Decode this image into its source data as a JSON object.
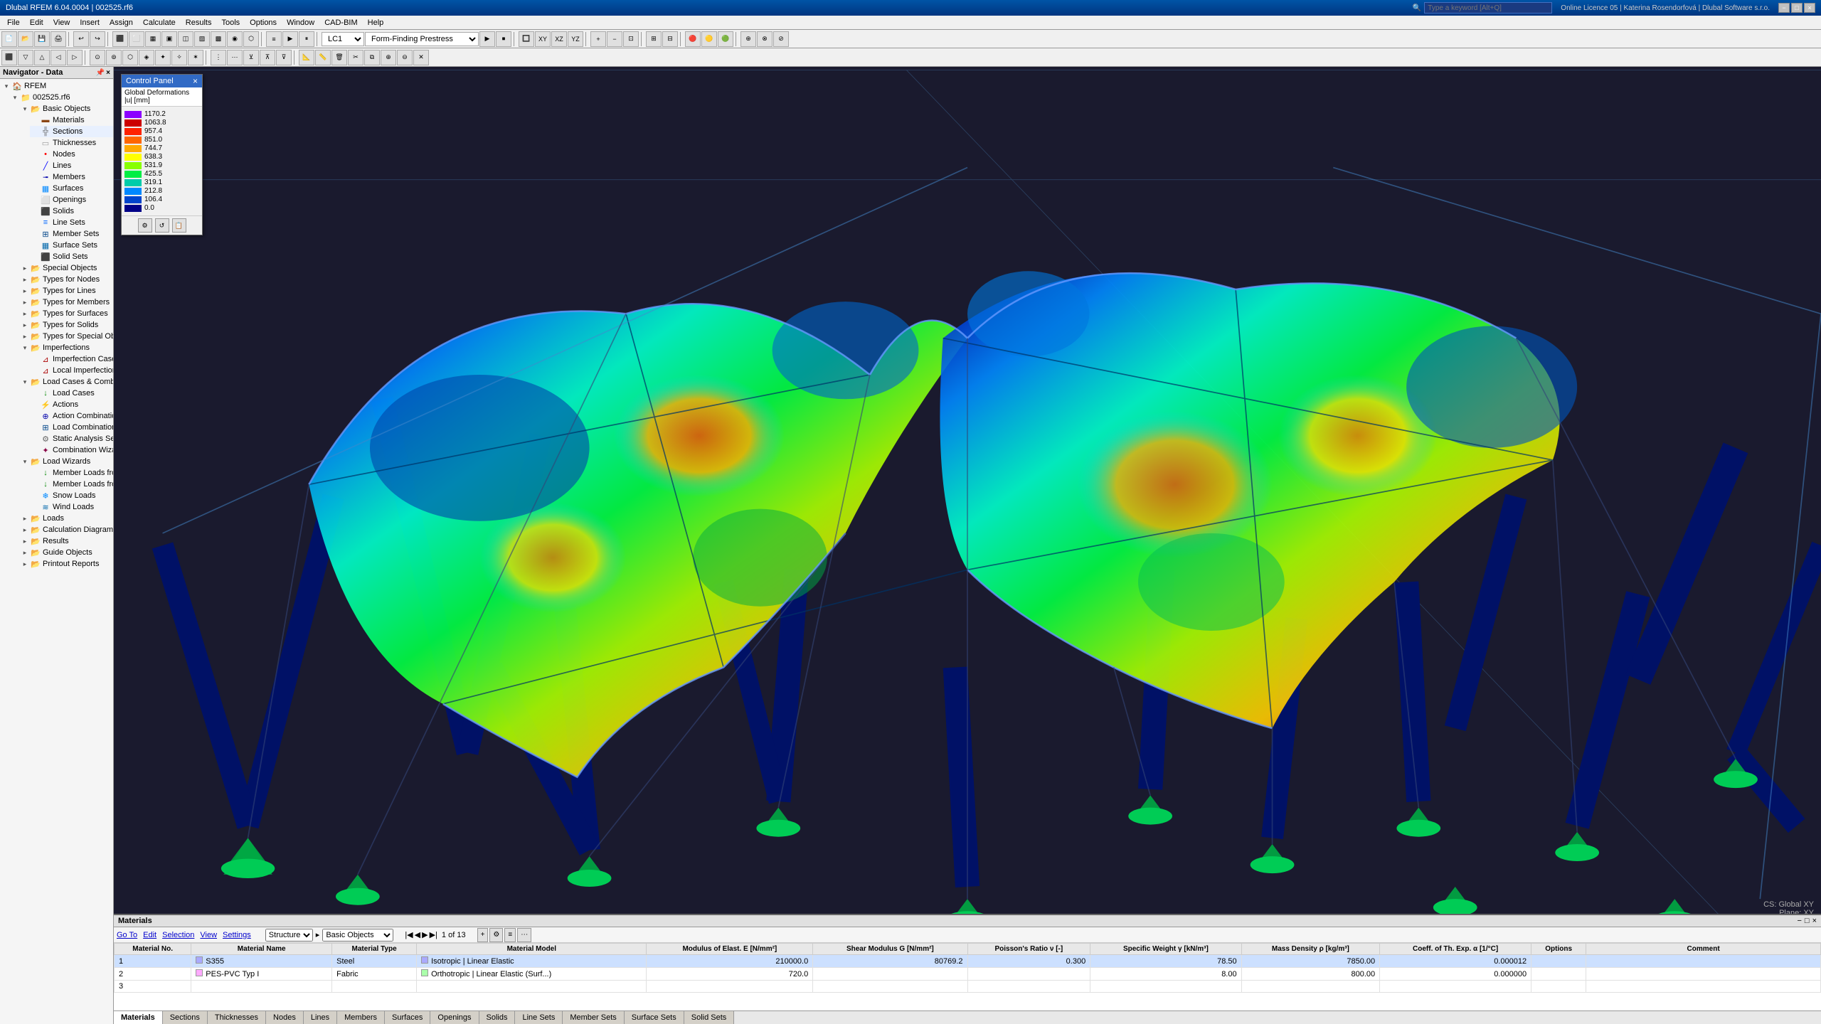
{
  "title_bar": {
    "title": "Dlubal RFEM 6.04.0004 | 002525.rf6",
    "search_placeholder": "Type a keyword [Alt+Q]",
    "license_info": "Online Licence 05 | Katerina Rosendorfová | Dlubal Software s.r.o.",
    "min_label": "−",
    "max_label": "□",
    "close_label": "×"
  },
  "menu": {
    "items": [
      "File",
      "Edit",
      "View",
      "Insert",
      "Assign",
      "Calculate",
      "Results",
      "Tools",
      "Options",
      "Window",
      "CAD-BIM",
      "Help"
    ]
  },
  "toolbar": {
    "lc_label": "LC1",
    "ff_label": "Form-Finding Prestress"
  },
  "navigator": {
    "title": "Navigator - Data",
    "rfem_label": "RFEM",
    "file_label": "002525.rf6",
    "sections": [
      {
        "label": "Basic Objects",
        "expanded": true,
        "level": 1,
        "icon": "folder"
      },
      {
        "label": "Materials",
        "expanded": false,
        "level": 2,
        "icon": "material"
      },
      {
        "label": "Sections",
        "expanded": false,
        "level": 2,
        "icon": "section"
      },
      {
        "label": "Thicknesses",
        "expanded": false,
        "level": 2,
        "icon": "thickness"
      },
      {
        "label": "Nodes",
        "expanded": false,
        "level": 2,
        "icon": "node"
      },
      {
        "label": "Lines",
        "expanded": false,
        "level": 2,
        "icon": "line"
      },
      {
        "label": "Members",
        "expanded": false,
        "level": 2,
        "icon": "member"
      },
      {
        "label": "Surfaces",
        "expanded": false,
        "level": 2,
        "icon": "surface"
      },
      {
        "label": "Openings",
        "expanded": false,
        "level": 2,
        "icon": "opening"
      },
      {
        "label": "Solids",
        "expanded": false,
        "level": 2,
        "icon": "solid"
      },
      {
        "label": "Line Sets",
        "expanded": false,
        "level": 2,
        "icon": "lineset"
      },
      {
        "label": "Member Sets",
        "expanded": false,
        "level": 2,
        "icon": "memberset"
      },
      {
        "label": "Surface Sets",
        "expanded": false,
        "level": 2,
        "icon": "surfaceset"
      },
      {
        "label": "Solid Sets",
        "expanded": false,
        "level": 2,
        "icon": "solidset"
      },
      {
        "label": "Special Objects",
        "expanded": false,
        "level": 1,
        "icon": "folder"
      },
      {
        "label": "Types for Nodes",
        "expanded": false,
        "level": 1,
        "icon": "folder"
      },
      {
        "label": "Types for Lines",
        "expanded": false,
        "level": 1,
        "icon": "folder"
      },
      {
        "label": "Types for Members",
        "expanded": false,
        "level": 1,
        "icon": "folder"
      },
      {
        "label": "Types for Surfaces",
        "expanded": false,
        "level": 1,
        "icon": "folder"
      },
      {
        "label": "Types for Solids",
        "expanded": false,
        "level": 1,
        "icon": "folder"
      },
      {
        "label": "Types for Special Objects",
        "expanded": false,
        "level": 1,
        "icon": "folder"
      },
      {
        "label": "Imperfections",
        "expanded": true,
        "level": 1,
        "icon": "folder"
      },
      {
        "label": "Imperfection Cases",
        "expanded": false,
        "level": 2,
        "icon": "imp"
      },
      {
        "label": "Local Imperfections",
        "expanded": false,
        "level": 2,
        "icon": "imp"
      },
      {
        "label": "Load Cases & Combinations",
        "expanded": true,
        "level": 1,
        "icon": "folder"
      },
      {
        "label": "Load Cases",
        "expanded": false,
        "level": 2,
        "icon": "lc"
      },
      {
        "label": "Actions",
        "expanded": false,
        "level": 2,
        "icon": "action"
      },
      {
        "label": "Action Combinations",
        "expanded": false,
        "level": 2,
        "icon": "combination"
      },
      {
        "label": "Load Combinations",
        "expanded": false,
        "level": 2,
        "icon": "combination"
      },
      {
        "label": "Static Analysis Settings",
        "expanded": false,
        "level": 2,
        "icon": "settings"
      },
      {
        "label": "Combination Wizards",
        "expanded": false,
        "level": 2,
        "icon": "wizard"
      },
      {
        "label": "Load Wizards",
        "expanded": true,
        "level": 1,
        "icon": "folder"
      },
      {
        "label": "Member Loads from Area Load",
        "expanded": false,
        "level": 2,
        "icon": "load"
      },
      {
        "label": "Member Loads from Free Line Load",
        "expanded": false,
        "level": 2,
        "icon": "load"
      },
      {
        "label": "Snow Loads",
        "expanded": false,
        "level": 2,
        "icon": "load"
      },
      {
        "label": "Wind Loads",
        "expanded": false,
        "level": 2,
        "icon": "load"
      },
      {
        "label": "Loads",
        "expanded": false,
        "level": 1,
        "icon": "folder"
      },
      {
        "label": "Calculation Diagrams",
        "expanded": false,
        "level": 1,
        "icon": "folder"
      },
      {
        "label": "Results",
        "expanded": false,
        "level": 1,
        "icon": "folder"
      },
      {
        "label": "Guide Objects",
        "expanded": false,
        "level": 1,
        "icon": "folder"
      },
      {
        "label": "Printout Reports",
        "expanded": false,
        "level": 1,
        "icon": "folder"
      }
    ]
  },
  "control_panel": {
    "title": "Control Panel",
    "close_label": "×",
    "subtitle": "Global Deformations",
    "unit": "|u| [mm]",
    "legend": [
      {
        "value": "1170.2",
        "color": "#8B00FF"
      },
      {
        "value": "1063.8",
        "color": "#CC0000"
      },
      {
        "value": "957.4",
        "color": "#FF2200"
      },
      {
        "value": "851.0",
        "color": "#FF6600"
      },
      {
        "value": "744.7",
        "color": "#FFAA00"
      },
      {
        "value": "638.3",
        "color": "#FFFF00"
      },
      {
        "value": "531.9",
        "color": "#88FF00"
      },
      {
        "value": "425.5",
        "color": "#00EE44"
      },
      {
        "value": "319.1",
        "color": "#00CCAA"
      },
      {
        "value": "212.8",
        "color": "#0088FF"
      },
      {
        "value": "106.4",
        "color": "#0044CC"
      },
      {
        "value": "0.0",
        "color": "#000088"
      }
    ],
    "footer_btns": [
      "⊞",
      "↺",
      "⊠"
    ]
  },
  "bottom_panel": {
    "title": "Materials",
    "toolbar": {
      "go_to": "Go To",
      "edit": "Edit",
      "selection": "Selection",
      "view": "View",
      "settings": "Settings",
      "filter_label": "Structure",
      "filter_sub": "Basic Objects"
    },
    "table": {
      "headers": [
        "Material No.",
        "Material Name",
        "Material Type",
        "Material Model",
        "Modulus of Elast. E [N/mm²]",
        "Shear Modulus G [N/mm²]",
        "Poisson's Ratio ν [-]",
        "Specific Weight γ [kN/m³]",
        "Mass Density ρ [kg/m³]",
        "Coeff. of Th. Exp. α [1/°C]",
        "Options",
        "Comment"
      ],
      "rows": [
        {
          "no": "1",
          "name": "S355",
          "type": "Steel",
          "model": "Isotropic | Linear Elastic",
          "E": "210000.0",
          "G": "80769.2",
          "nu": "0.300",
          "gamma": "78.50",
          "rho": "7850.00",
          "alpha": "0.000012",
          "options": "",
          "comment": "",
          "selected": true
        },
        {
          "no": "2",
          "name": "PES-PVC Typ I",
          "type": "Fabric",
          "model": "Orthotropic | Linear Elastic (Surf...)",
          "E": "720.0",
          "G": "",
          "nu": "",
          "gamma": "8.00",
          "rho": "800.00",
          "alpha": "0.000000",
          "options": "",
          "comment": "",
          "selected": false
        },
        {
          "no": "3",
          "name": "",
          "type": "",
          "model": "",
          "E": "",
          "G": "",
          "nu": "",
          "gamma": "",
          "rho": "",
          "alpha": "",
          "options": "",
          "comment": "",
          "selected": false
        }
      ]
    },
    "tabs": [
      "Materials",
      "Sections",
      "Thicknesses",
      "Nodes",
      "Lines",
      "Members",
      "Surfaces",
      "Openings",
      "Solids",
      "Line Sets",
      "Member Sets",
      "Surface Sets",
      "Solid Sets"
    ],
    "active_tab": "Materials",
    "page_info": "1 of 13",
    "close_label": "×",
    "minimize_label": "−"
  },
  "status_bar": {
    "cs": "CS: Global XY",
    "plane": "Plane: XY"
  }
}
